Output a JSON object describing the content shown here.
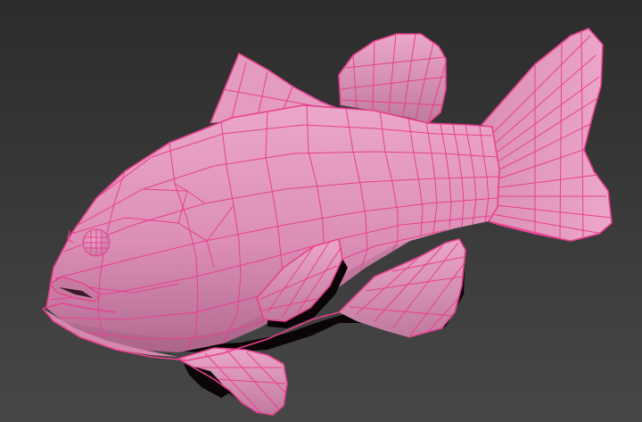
{
  "viewport": {
    "background_top": "#2c2c2c",
    "background_bottom": "#474747"
  },
  "model": {
    "subject": "fish",
    "display_mode": "shaded-with-wireframe",
    "surface_color": "#dc8fb6",
    "surface_light": "#eba7c9",
    "surface_shadow": "#a35c81",
    "wire_color": "#e83f8f",
    "cavity_color": "#0c0508"
  }
}
